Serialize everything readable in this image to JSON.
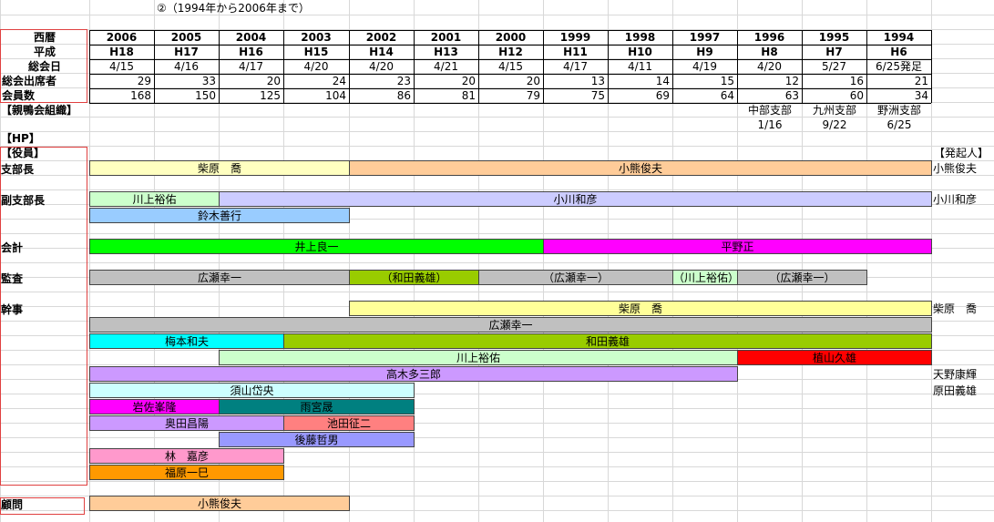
{
  "page_title": "②（1994年から2006年まで）",
  "header": {
    "row_labels": [
      "西暦",
      "平成",
      "総会日",
      "総会出席者",
      "会員数"
    ],
    "years": [
      "2006",
      "2005",
      "2004",
      "2003",
      "2002",
      "2001",
      "2000",
      "1999",
      "1998",
      "1997",
      "1996",
      "1995",
      "1994"
    ],
    "heisei": [
      "H18",
      "H17",
      "H16",
      "H15",
      "H14",
      "H13",
      "H12",
      "H11",
      "H10",
      "H9",
      "H8",
      "H7",
      "H6"
    ],
    "dates": [
      "4/15",
      "4/16",
      "4/17",
      "4/20",
      "4/20",
      "4/21",
      "4/15",
      "4/17",
      "4/11",
      "4/19",
      "4/20",
      "5/27",
      "6/25発足"
    ],
    "attendees": [
      "29",
      "33",
      "20",
      "24",
      "23",
      "20",
      "20",
      "13",
      "14",
      "15",
      "12",
      "16",
      "21"
    ],
    "members": [
      "168",
      "150",
      "125",
      "104",
      "86",
      "81",
      "79",
      "75",
      "69",
      "64",
      "63",
      "60",
      "34"
    ]
  },
  "section_labels": {
    "org": "【親鴨会組織】",
    "hp": "【HP】",
    "officers": "【役員】",
    "founders": "【発起人】",
    "branch_chief": "支部長",
    "vice_chief": "副支部長",
    "accounting": "会計",
    "audit": "監査",
    "secretary": "幹事",
    "advisor": "顧問"
  },
  "branches": [
    {
      "name": "中部支部",
      "date": "1/16"
    },
    {
      "name": "九州支部",
      "date": "9/22"
    },
    {
      "name": "野洲支部",
      "date": "6/25"
    }
  ],
  "bars": [
    {
      "label": "柴原　喬",
      "color": "#ffffc0"
    },
    {
      "label": "小熊俊夫",
      "color": "#ffcc99"
    },
    {
      "label": "川上裕佑",
      "color": "#ccffcc"
    },
    {
      "label": "小川和彦",
      "color": "#ccccff"
    },
    {
      "label": "鈴木善行",
      "color": "#99ccff"
    },
    {
      "label": "井上良一",
      "color": "#00ff00"
    },
    {
      "label": "平野正",
      "color": "#ff00ff"
    },
    {
      "label": "広瀬幸一",
      "color": "#c0c0c0"
    },
    {
      "label": "（和田義雄）",
      "color": "#99cc00"
    },
    {
      "label": "（広瀬幸一）",
      "color": "#c0c0c0"
    },
    {
      "label": "（川上裕佑）",
      "color": "#ccffcc"
    },
    {
      "label": "（広瀬幸一）",
      "color": "#c0c0c0"
    },
    {
      "label": "柴原　喬",
      "color": "#ffff99"
    },
    {
      "label": "広瀬幸一",
      "color": "#c0c0c0"
    },
    {
      "label": "梅本和夫",
      "color": "#00ffff"
    },
    {
      "label": "和田義雄",
      "color": "#99cc00"
    },
    {
      "label": "川上裕佑",
      "color": "#ccffcc"
    },
    {
      "label": "植山久雄",
      "color": "#ff0000"
    },
    {
      "label": "高木多三郎",
      "color": "#cc99ff"
    },
    {
      "label": "須山岱央",
      "color": "#ccffff"
    },
    {
      "label": "岩佐峯隆",
      "color": "#ff00ff"
    },
    {
      "label": "雨宮晟",
      "color": "#008080"
    },
    {
      "label": "奥田昌陽",
      "color": "#cc99ff"
    },
    {
      "label": "池田征二",
      "color": "#ff8080"
    },
    {
      "label": "後藤哲男",
      "color": "#9999ff"
    },
    {
      "label": "林　嘉彦",
      "color": "#ff99cc"
    },
    {
      "label": "福原一巳",
      "color": "#ff9900"
    },
    {
      "label": "小熊俊夫",
      "color": "#ffcc99"
    }
  ],
  "founders": [
    "小熊俊夫",
    "小川和彦",
    "柴原　喬",
    "天野康輝",
    "原田義雄"
  ]
}
